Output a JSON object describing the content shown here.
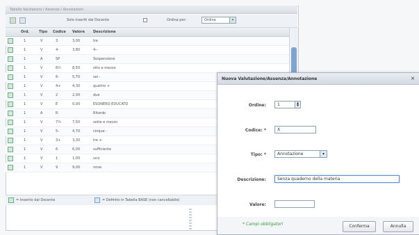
{
  "background_window": {
    "title": "Tabelle Valutazioni / Assenze / Annotazioni",
    "toolbar": {
      "only_teacher_label": "Solo inseriti dal Docente",
      "order_label": "Ordina per:",
      "order_value": "Ordine"
    },
    "columns": [
      "Ord.",
      "Tipo",
      "Codice",
      "Valore",
      "Descrizione"
    ],
    "rows": [
      {
        "ord": "1",
        "tipo": "V",
        "codice": "3",
        "valore": "3,00",
        "desc": "tre"
      },
      {
        "ord": "1",
        "tipo": "V",
        "codice": "4-",
        "valore": "3,80",
        "desc": "4--"
      },
      {
        "ord": "1",
        "tipo": "A",
        "codice": "SP",
        "valore": "",
        "desc": "Sospensione"
      },
      {
        "ord": "1",
        "tipo": "V",
        "codice": "8½",
        "valore": "8,50",
        "desc": "otto e mezzo"
      },
      {
        "ord": "1",
        "tipo": "V",
        "codice": "6-",
        "valore": "5,70",
        "desc": "sei -"
      },
      {
        "ord": "1",
        "tipo": "V",
        "codice": "4+",
        "valore": "4,30",
        "desc": "quattro +"
      },
      {
        "ord": "1",
        "tipo": "V",
        "codice": "2",
        "valore": "2,00",
        "desc": "due"
      },
      {
        "ord": "1",
        "tipo": "V",
        "codice": "E",
        "valore": "0,00",
        "desc": "ESONERO EDUCATO"
      },
      {
        "ord": "1",
        "tipo": "A",
        "codice": "R",
        "valore": "",
        "desc": "Ritardo"
      },
      {
        "ord": "1",
        "tipo": "V",
        "codice": "7½",
        "valore": "7,50",
        "desc": "sette e mezzo"
      },
      {
        "ord": "1",
        "tipo": "V",
        "codice": "5-",
        "valore": "4,70",
        "desc": "cinque -"
      },
      {
        "ord": "1",
        "tipo": "V",
        "codice": "3+",
        "valore": "3,30",
        "desc": "tre +"
      },
      {
        "ord": "1",
        "tipo": "V",
        "codice": "6",
        "valore": "6,00",
        "desc": "sufficiente"
      },
      {
        "ord": "1",
        "tipo": "V",
        "codice": "1",
        "valore": "1,00",
        "desc": "uno"
      },
      {
        "ord": "1",
        "tipo": "V",
        "codice": "9",
        "valore": "9,00",
        "desc": "nove"
      }
    ],
    "legend": {
      "item1": "= Inserito dal Docente",
      "item2": "= Definito in Tabella BASE (non cancellabile)"
    }
  },
  "modal": {
    "title": "Nuova Valutazione/Assenza/Annotazione",
    "fields": {
      "ordine_label": "Ordine:",
      "ordine_value": "1",
      "codice_label": "Codice: *",
      "codice_value": "X",
      "tipo_label": "Tipo: *",
      "tipo_value": "Annotazione",
      "descrizione_label": "Descrizione:",
      "descrizione_value": "Senza quaderno della materia",
      "valore_label": "Valore:",
      "valore_value": ""
    },
    "required_note": "* Campi obbligatori",
    "confirm_button": "Conferma",
    "cancel_button": "Annulla"
  },
  "colors": {
    "accent": "#5b8fd0",
    "required": "#3a9a3a",
    "icon_green": "#d6ead0"
  }
}
